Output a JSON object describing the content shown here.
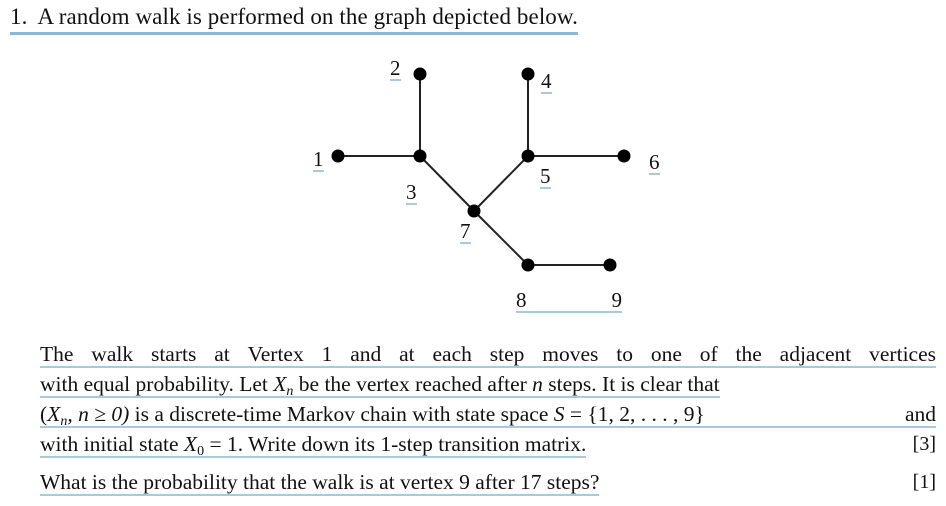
{
  "question": {
    "number": "1.",
    "title": "A random walk is performed on the graph depicted below."
  },
  "graph": {
    "vertices": [
      {
        "id": 1,
        "label": "1"
      },
      {
        "id": 2,
        "label": "2"
      },
      {
        "id": 3,
        "label": "3"
      },
      {
        "id": 4,
        "label": "4"
      },
      {
        "id": 5,
        "label": "5"
      },
      {
        "id": 6,
        "label": "6"
      },
      {
        "id": 7,
        "label": "7"
      },
      {
        "id": 8,
        "label": "8"
      },
      {
        "id": 9,
        "label": "9"
      }
    ],
    "edges": [
      [
        1,
        3
      ],
      [
        2,
        3
      ],
      [
        3,
        7
      ],
      [
        4,
        5
      ],
      [
        5,
        6
      ],
      [
        5,
        7
      ],
      [
        7,
        8
      ],
      [
        8,
        9
      ]
    ],
    "vertex_color": "#000000",
    "edge_color": "#222222"
  },
  "body": {
    "line1": [
      "The",
      "walk",
      "starts",
      "at",
      "Vertex",
      "1",
      "and",
      "at",
      "each",
      "step",
      "moves",
      "to",
      "one",
      "of",
      "the",
      "adjacent",
      "vertices"
    ],
    "line2": {
      "pre": "with equal probability. Let ",
      "var": "X",
      "sub": "n",
      "mid": " be the vertex reached after ",
      "n": "n",
      "post": " steps. It is clear that"
    },
    "line3": {
      "open": "(",
      "var": "X",
      "sub": "n",
      "cond": ", n ≥ 0)",
      "mid": " is a discrete-time Markov chain with state space ",
      "S": "S",
      "set": " = {1, 2, . . . , 9}",
      "post": " and"
    },
    "line4": {
      "pre": "with initial state ",
      "var": "X",
      "sub": "0",
      "post": " = 1. Write down its 1-step transition matrix.",
      "marks": "[3]"
    },
    "line5": {
      "text": "What is the probability that the walk is at vertex 9 after 17 steps?",
      "marks": "[1]"
    }
  }
}
